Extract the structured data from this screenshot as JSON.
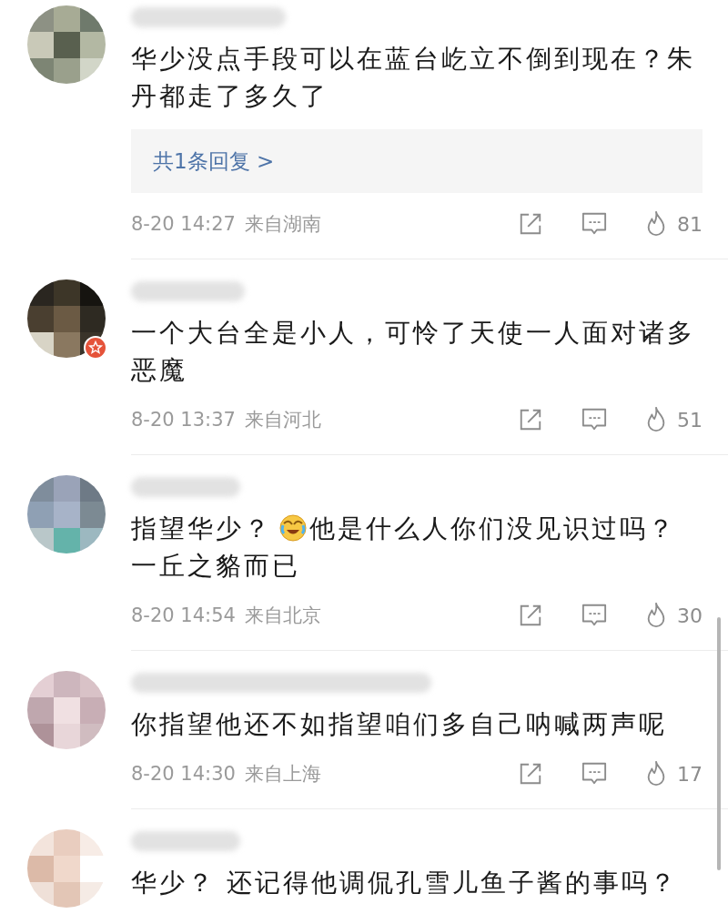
{
  "comments": [
    {
      "verified": false,
      "text_parts": [
        {
          "text": "华少没点手段可以在蓝台屹立不倒到现在？朱丹都走了多久了"
        }
      ],
      "replies": "共1条回复 >",
      "date": "8-20 14:27",
      "location": "来自湖南",
      "likes": "81"
    },
    {
      "verified": true,
      "text_parts": [
        {
          "text": "一个大台全是小人，可怜了天使一人面对诸多恶魔"
        }
      ],
      "date": "8-20 13:37",
      "location": "来自河北",
      "likes": "51"
    },
    {
      "verified": false,
      "text_parts": [
        {
          "emoji_before": false,
          "text": "指望华少？"
        },
        {
          "emoji_before": true,
          "text": "他是什么人你们没见识过吗？"
        },
        {
          "emoji_before": false,
          "text": "一丘之貉而已"
        }
      ],
      "date": "8-20 14:54",
      "location": "来自北京",
      "likes": "30"
    },
    {
      "verified": false,
      "text_parts": [
        {
          "text": "你指望他还不如指望咱们多自己呐喊两声呢"
        }
      ],
      "date": "8-20 14:30",
      "location": "来自上海",
      "likes": "17"
    },
    {
      "verified": false,
      "text_parts": [
        {
          "text": "华少？  还记得他调侃孔雪儿鱼子酱的事吗？"
        }
      ]
    }
  ]
}
